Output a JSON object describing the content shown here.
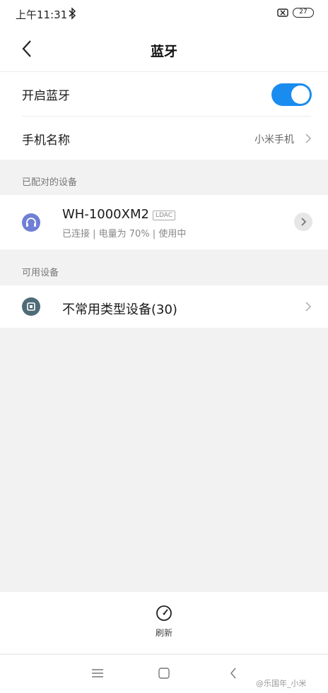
{
  "status_bar": {
    "time": "上午11:31",
    "battery": "27"
  },
  "header": {
    "title": "蓝牙"
  },
  "settings": {
    "bluetooth_label": "开启蓝牙",
    "bluetooth_on": true,
    "device_name_label": "手机名称",
    "device_name_value": "小米手机"
  },
  "paired": {
    "section_label": "已配对的设备",
    "devices": [
      {
        "name": "WH-1000XM2",
        "codec": "LDAC",
        "status": "已连接 | 电量为 70% | 使用中",
        "icon": "headphones-icon",
        "icon_color": "#6f7fd6"
      }
    ]
  },
  "available": {
    "section_label": "可用设备",
    "devices": [
      {
        "name": "不常用类型设备(30)",
        "icon": "device-icon",
        "icon_color": "#4e6b78"
      }
    ]
  },
  "bottom_bar": {
    "refresh_label": "刷新"
  },
  "nav": {
    "watermark": "@乐国年_小米"
  },
  "colors": {
    "accent": "#1a8cf0",
    "background": "#f2f2f2"
  }
}
